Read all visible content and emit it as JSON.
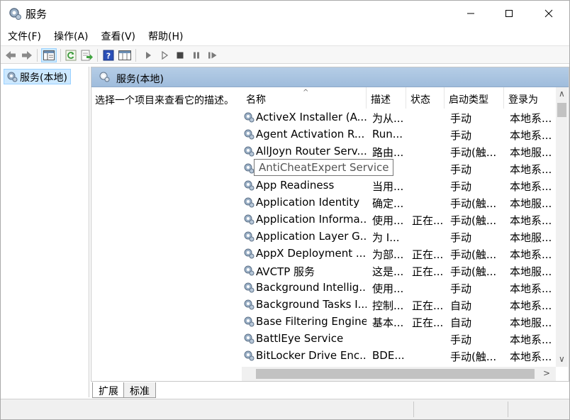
{
  "window": {
    "title": "服务"
  },
  "menu": [
    "文件(F)",
    "操作(A)",
    "查看(V)",
    "帮助(H)"
  ],
  "toolbar": {
    "icons": [
      "back-arrow-icon",
      "forward-arrow-icon",
      "show-console-tree-icon",
      "refresh-icon",
      "export-list-icon",
      "help-icon",
      "properties-icon",
      "start-service-icon",
      "start-service-alt-icon",
      "stop-service-icon",
      "pause-service-icon",
      "restart-service-icon"
    ]
  },
  "tree": {
    "item": "服务(本地)"
  },
  "pane": {
    "header": "服务(本地)",
    "description": "选择一个项目来查看它的描述。"
  },
  "columns": {
    "name": "名称",
    "desc": "描述",
    "status": "状态",
    "startup": "启动类型",
    "logon": "登录为"
  },
  "services": [
    {
      "name": "ActiveX Installer (A...",
      "desc": "为从...",
      "status": "",
      "startup": "手动",
      "logon": "本地系..."
    },
    {
      "name": "Agent Activation R...",
      "desc": "Run...",
      "status": "",
      "startup": "手动",
      "logon": "本地系..."
    },
    {
      "name": "AllJoyn Router Serv...",
      "desc": "路由...",
      "status": "",
      "startup": "手动(触...",
      "logon": "本地服..."
    },
    {
      "name": "",
      "desc": "r...",
      "status": "",
      "startup": "手动",
      "logon": "本地系..."
    },
    {
      "name": "App Readiness",
      "desc": "当用...",
      "status": "",
      "startup": "手动",
      "logon": "本地系..."
    },
    {
      "name": "Application Identity",
      "desc": "确定...",
      "status": "",
      "startup": "手动(触...",
      "logon": "本地服..."
    },
    {
      "name": "Application Informa...",
      "desc": "使用...",
      "status": "正在...",
      "startup": "手动(触...",
      "logon": "本地系..."
    },
    {
      "name": "Application Layer G...",
      "desc": "为 I...",
      "status": "",
      "startup": "手动",
      "logon": "本地服..."
    },
    {
      "name": "AppX Deployment ...",
      "desc": "为部...",
      "status": "正在...",
      "startup": "手动(触...",
      "logon": "本地系..."
    },
    {
      "name": "AVCTP 服务",
      "desc": "这是...",
      "status": "正在...",
      "startup": "手动(触...",
      "logon": "本地服..."
    },
    {
      "name": "Background Intellig...",
      "desc": "使用...",
      "status": "",
      "startup": "手动",
      "logon": "本地系..."
    },
    {
      "name": "Background Tasks I...",
      "desc": "控制...",
      "status": "正在...",
      "startup": "自动",
      "logon": "本地系..."
    },
    {
      "name": "Base Filtering Engine",
      "desc": "基本...",
      "status": "正在...",
      "startup": "自动",
      "logon": "本地服..."
    },
    {
      "name": "BattlEye Service",
      "desc": "",
      "status": "",
      "startup": "手动",
      "logon": "本地系..."
    },
    {
      "name": "BitLocker Drive Enc...",
      "desc": "BDE...",
      "status": "",
      "startup": "手动(触...",
      "logon": "本地系..."
    }
  ],
  "tooltip": "AntiCheatExpert Service",
  "tabs": {
    "extended": "扩展",
    "standard": "标准"
  },
  "colors": {
    "header_blue": "#a9c4e2",
    "selection": "#cce8ff"
  }
}
